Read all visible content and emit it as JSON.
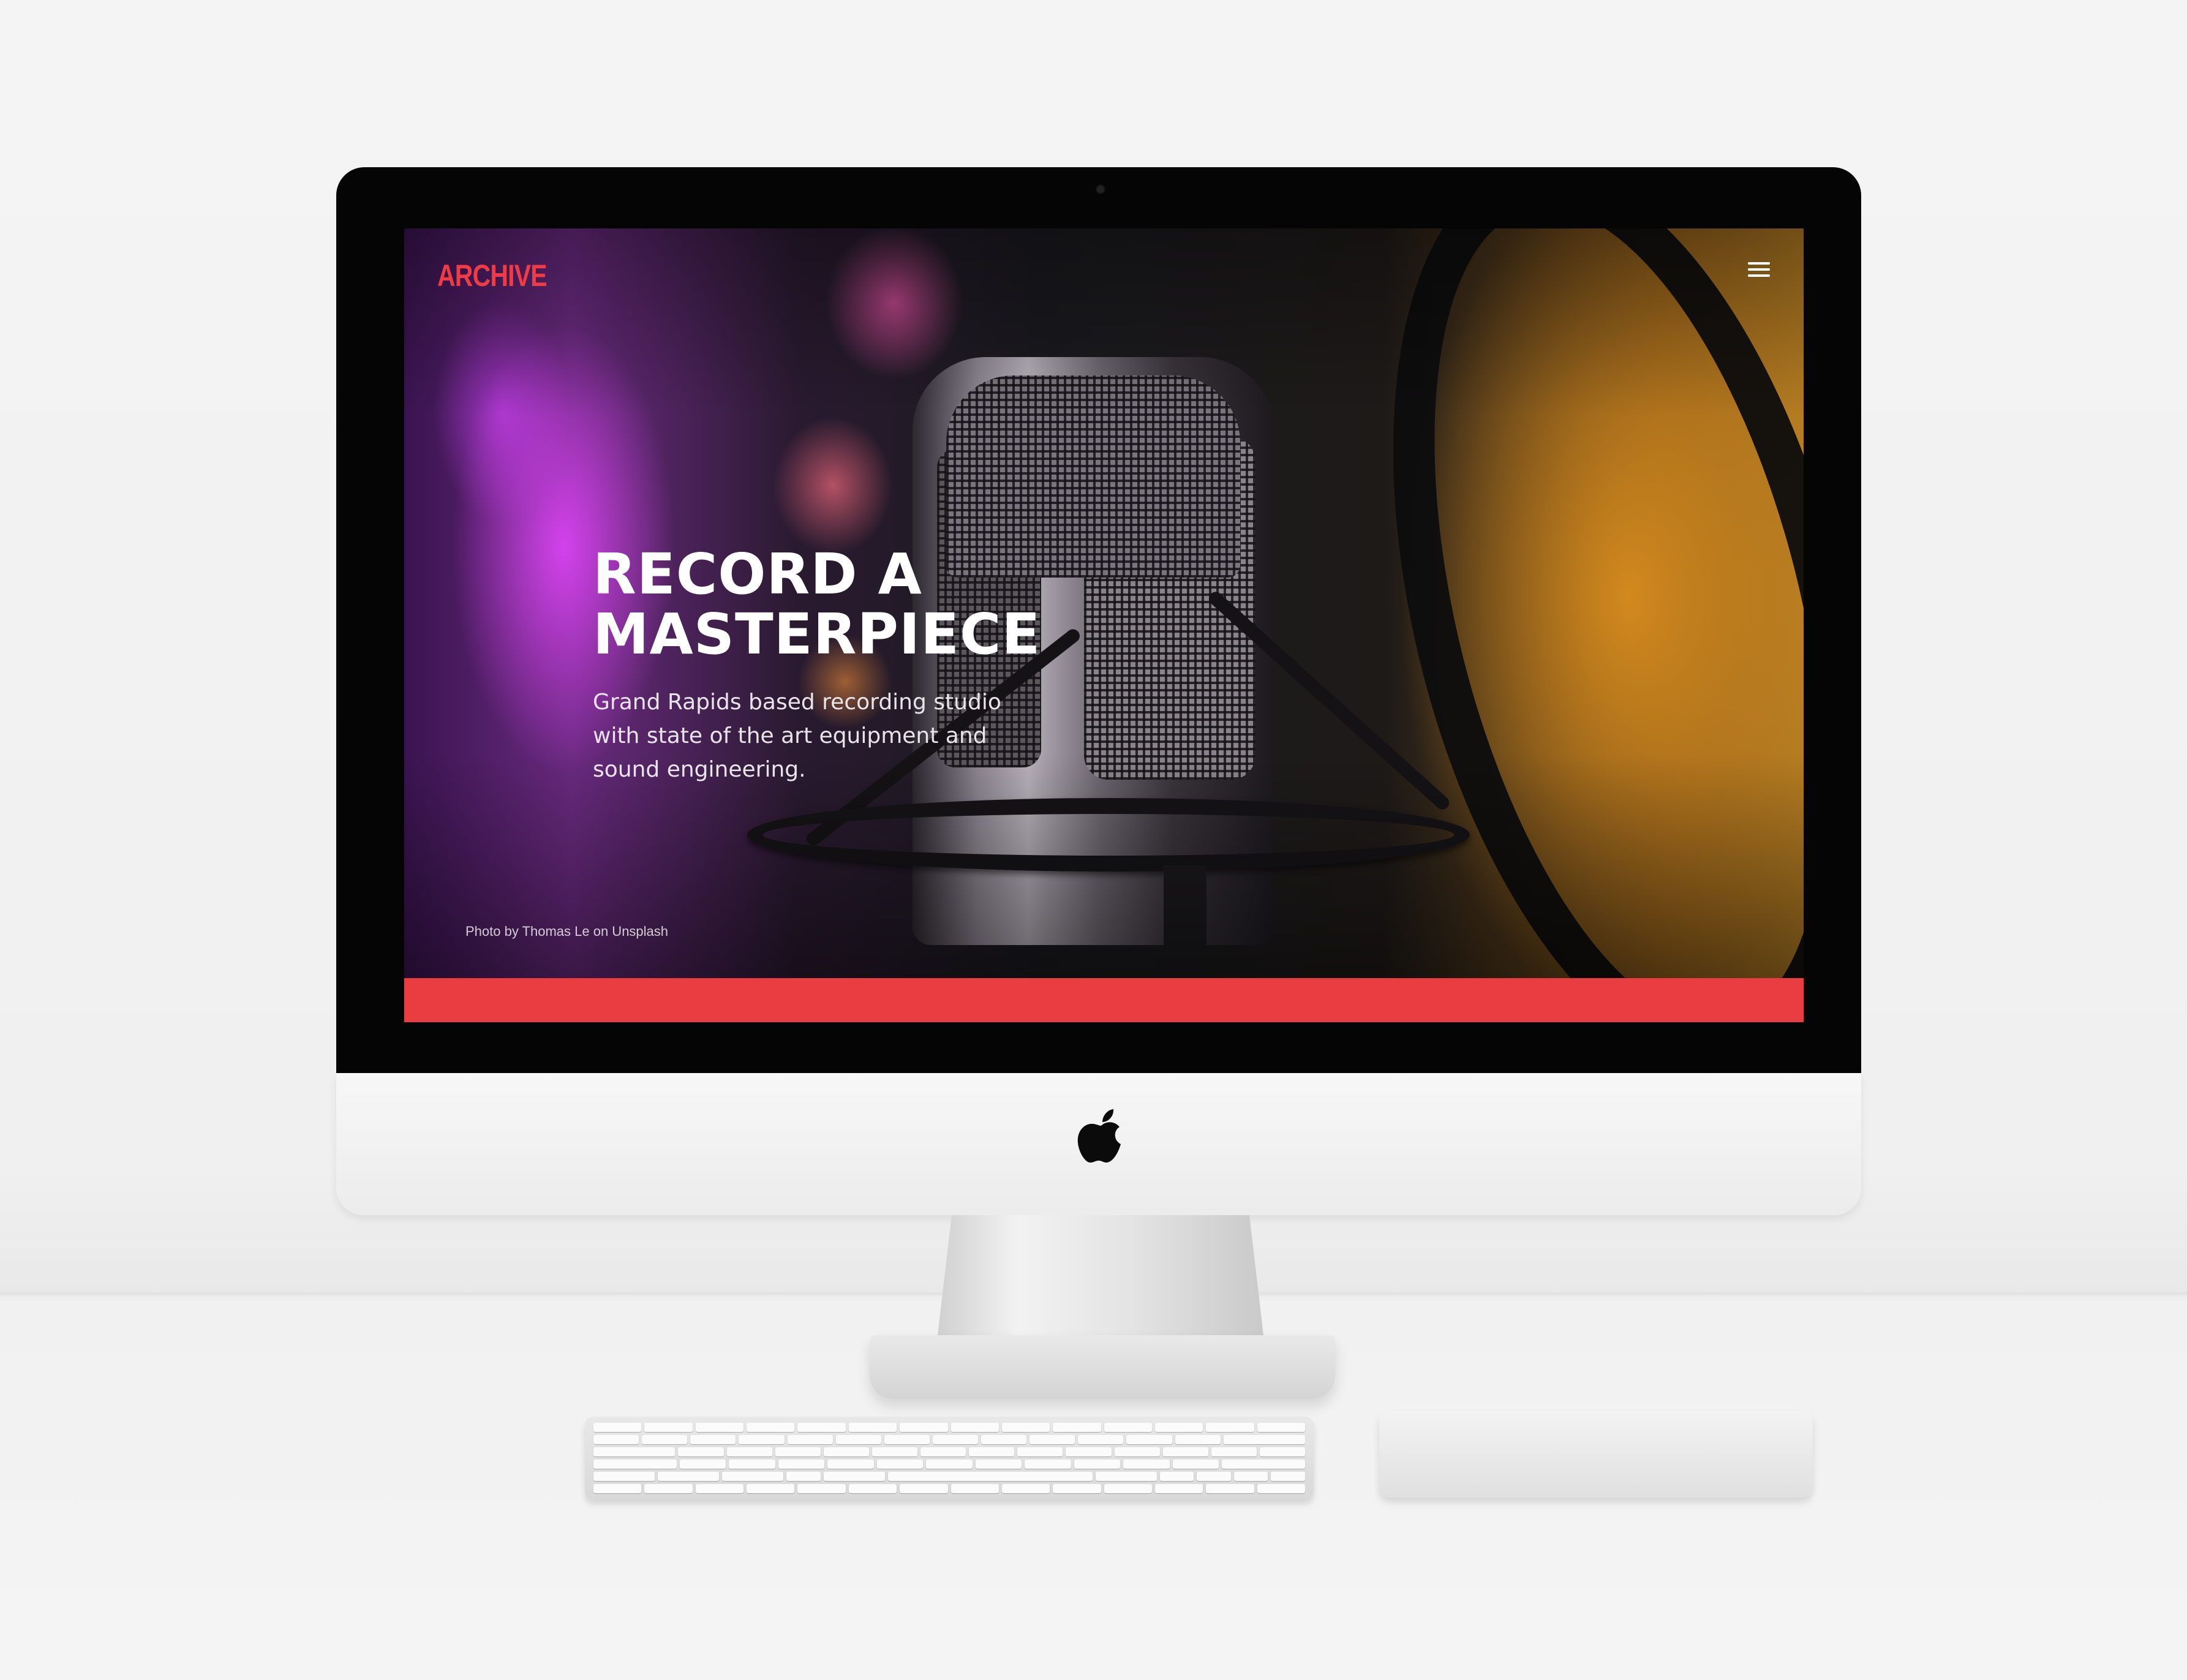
{
  "site": {
    "logo_text": "ARCHIVE",
    "menu_icon": "hamburger-menu-icon",
    "brand_color": "#ea3d41"
  },
  "hero": {
    "title": "RECORD A\nMASTERPIECE",
    "subtitle": "Grand Rapids based recording studio with state of the art equipment and sound engineering.",
    "photo_credit": "Photo by Thomas Le on Unsplash"
  },
  "device": {
    "logo_icon": "apple-logo-icon"
  }
}
